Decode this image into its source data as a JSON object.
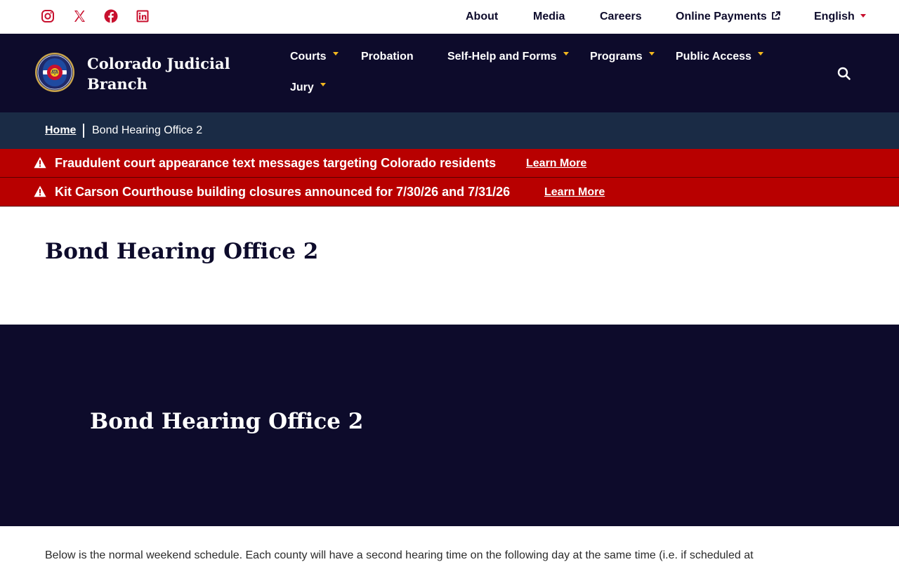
{
  "social": {
    "icons": [
      "instagram-icon",
      "x-icon",
      "facebook-icon",
      "linkedin-icon"
    ],
    "color": "#c8102e"
  },
  "utility_nav": {
    "about": "About",
    "media": "Media",
    "careers": "Careers",
    "online_payments": "Online Payments",
    "language": "English"
  },
  "header": {
    "brand": "Colorado Judicial Branch",
    "background": "#0d0b2b",
    "nav": {
      "courts": "Courts",
      "probation": "Probation",
      "self_help": "Self-Help and Forms",
      "programs": "Programs",
      "public_access": "Public Access",
      "jury": "Jury"
    },
    "accent": "#f2b81f"
  },
  "breadcrumb": {
    "home": "Home",
    "current": "Bond Hearing Office 2"
  },
  "alerts": [
    {
      "message": "Fraudulent court appearance text messages targeting Colorado residents",
      "link": "Learn More"
    },
    {
      "message": "Kit Carson Courthouse building closures announced for 7/30/26 and 7/31/26",
      "link": "Learn More"
    }
  ],
  "alert_color": "#b80000",
  "page": {
    "title": "Bond Hearing Office 2",
    "hero_title": "Bond Hearing Office 2",
    "intro": "Below is the normal weekend schedule.  Each county will have a second hearing time on the following day at the same time (i.e. if scheduled at"
  }
}
